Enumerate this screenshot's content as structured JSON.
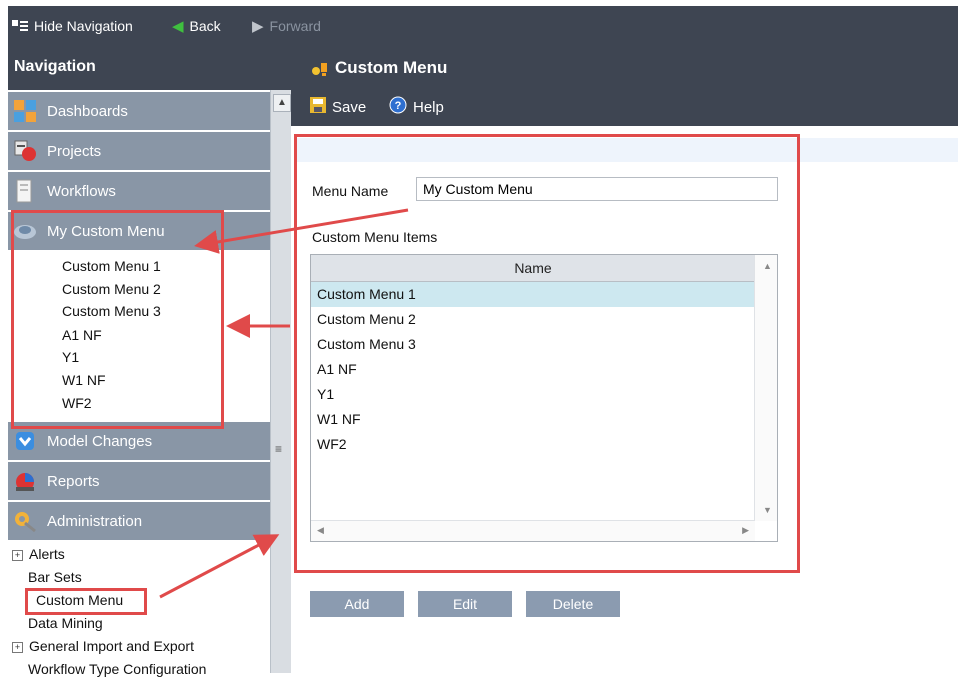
{
  "toolbar": {
    "hide_navigation": "Hide Navigation",
    "back": "Back",
    "forward": "Forward"
  },
  "navigation": {
    "title": "Navigation",
    "sections": [
      {
        "label": "Dashboards",
        "icon": "dashboard-icon"
      },
      {
        "label": "Projects",
        "icon": "projects-icon"
      },
      {
        "label": "Workflows",
        "icon": "workflows-icon"
      },
      {
        "label": "My Custom Menu",
        "icon": "custom-menu-icon"
      },
      {
        "label": "Model Changes",
        "icon": "model-changes-icon"
      },
      {
        "label": "Reports",
        "icon": "reports-icon"
      },
      {
        "label": "Administration",
        "icon": "administration-icon"
      }
    ],
    "custom_menu_items": [
      "Custom Menu 1",
      "Custom Menu 2",
      "Custom Menu 3",
      "A1 NF",
      "Y1",
      "W1 NF",
      "WF2"
    ],
    "admin_items": [
      {
        "label": "Alerts",
        "expandable": true
      },
      {
        "label": "Bar Sets",
        "expandable": false
      },
      {
        "label": "Custom Menu",
        "expandable": false
      },
      {
        "label": "Data Mining",
        "expandable": false
      },
      {
        "label": "General Import and Export",
        "expandable": true
      },
      {
        "label": "Workflow Type Configuration",
        "expandable": false
      }
    ]
  },
  "page": {
    "title": "Custom Menu",
    "save": "Save",
    "help": "Help",
    "menu_name_label": "Menu Name",
    "menu_name_value": "My Custom Menu",
    "items_label": "Custom Menu Items",
    "grid_header": "Name",
    "items": [
      "Custom Menu 1",
      "Custom Menu 2",
      "Custom Menu 3",
      "A1 NF",
      "Y1",
      "W1 NF",
      "WF2"
    ],
    "selected_index": 0,
    "buttons": {
      "add": "Add",
      "edit": "Edit",
      "delete": "Delete"
    }
  },
  "colors": {
    "header_bg": "#3e4552",
    "nav_section_bg": "#8996a6",
    "selected_row": "#cde8f0",
    "annotation": "#e04a4a",
    "button_bg": "#8b9bb0"
  }
}
